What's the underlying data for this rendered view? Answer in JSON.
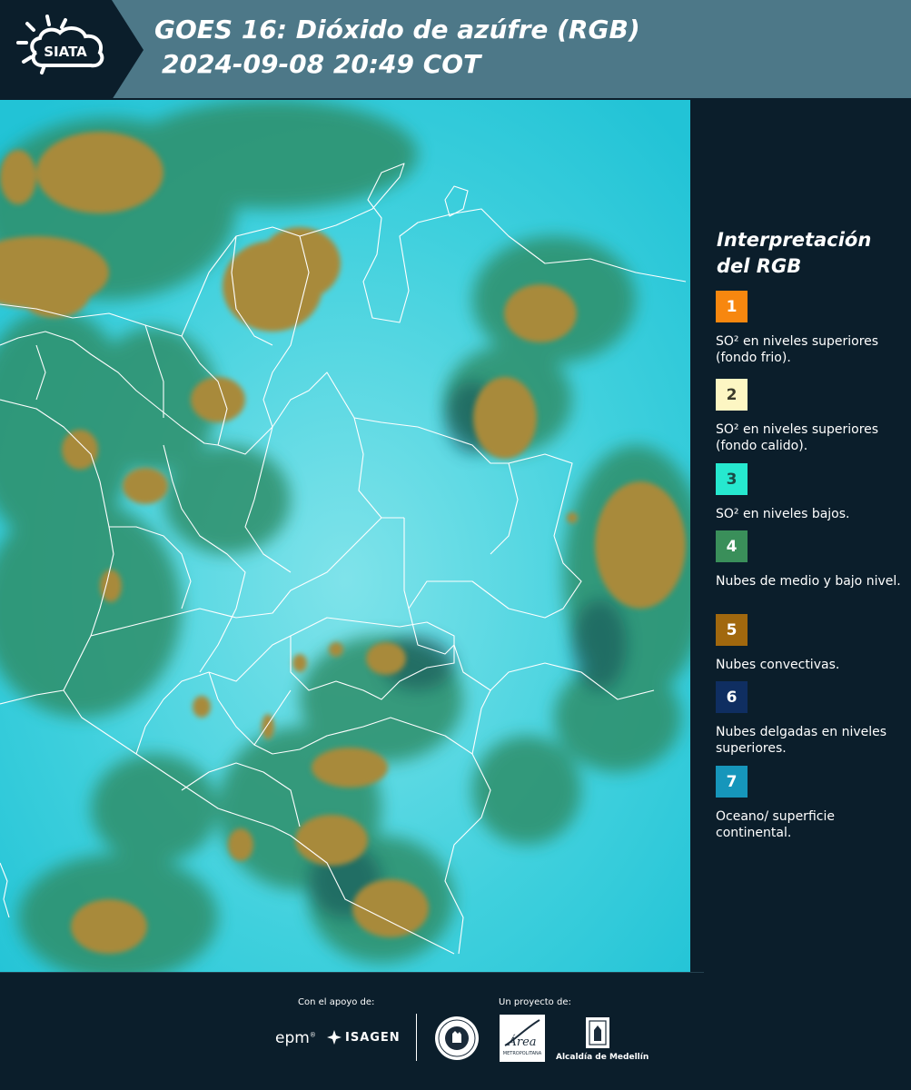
{
  "header": {
    "logo_text": "SIATA",
    "title_line1": "GOES 16: Dióxido de azúfre (RGB)",
    "title_line2": "2024-09-08 20:49 COT"
  },
  "legend": {
    "title": "Interpretación del RGB",
    "items": [
      {
        "number": "1",
        "label": "SO² en niveles superiores (fondo frio).",
        "color": "#f7870f",
        "text_color": "#ffffff"
      },
      {
        "number": "2",
        "label": "SO² en niveles superiores (fondo calido).",
        "color": "#fdf6c3",
        "text_color": "#3a3a2a"
      },
      {
        "number": "3",
        "label": "SO² en niveles bajos.",
        "color": "#26e8cf",
        "text_color": "#1a4a44"
      },
      {
        "number": "4",
        "label": "Nubes de medio y bajo nivel.",
        "color": "#3a8f5a",
        "text_color": "#ffffff"
      },
      {
        "number": "5",
        "label": "Nubes convectivas.",
        "color": "#a1680e",
        "text_color": "#ffffff"
      },
      {
        "number": "6",
        "label": "Nubes delgadas en niveles superiores.",
        "color": "#0f2e61",
        "text_color": "#ffffff"
      },
      {
        "number": "7",
        "label": "Oceano/ superficie continental.",
        "color": "#1696bb",
        "text_color": "#ffffff"
      }
    ]
  },
  "footer": {
    "support_label": "Con el apoyo de:",
    "project_label": "Un proyecto de:",
    "epm": "epm",
    "isagen": "ISAGEN",
    "area_text": "Área",
    "area_sub": "METROPOLITANA",
    "alcaldia": "Alcaldía de Medellín"
  },
  "map_colors": {
    "background": "#2fc6d6",
    "convective": "#a88a3a",
    "mid_low": "#2e8f6a",
    "boundary": "#ffffff"
  }
}
